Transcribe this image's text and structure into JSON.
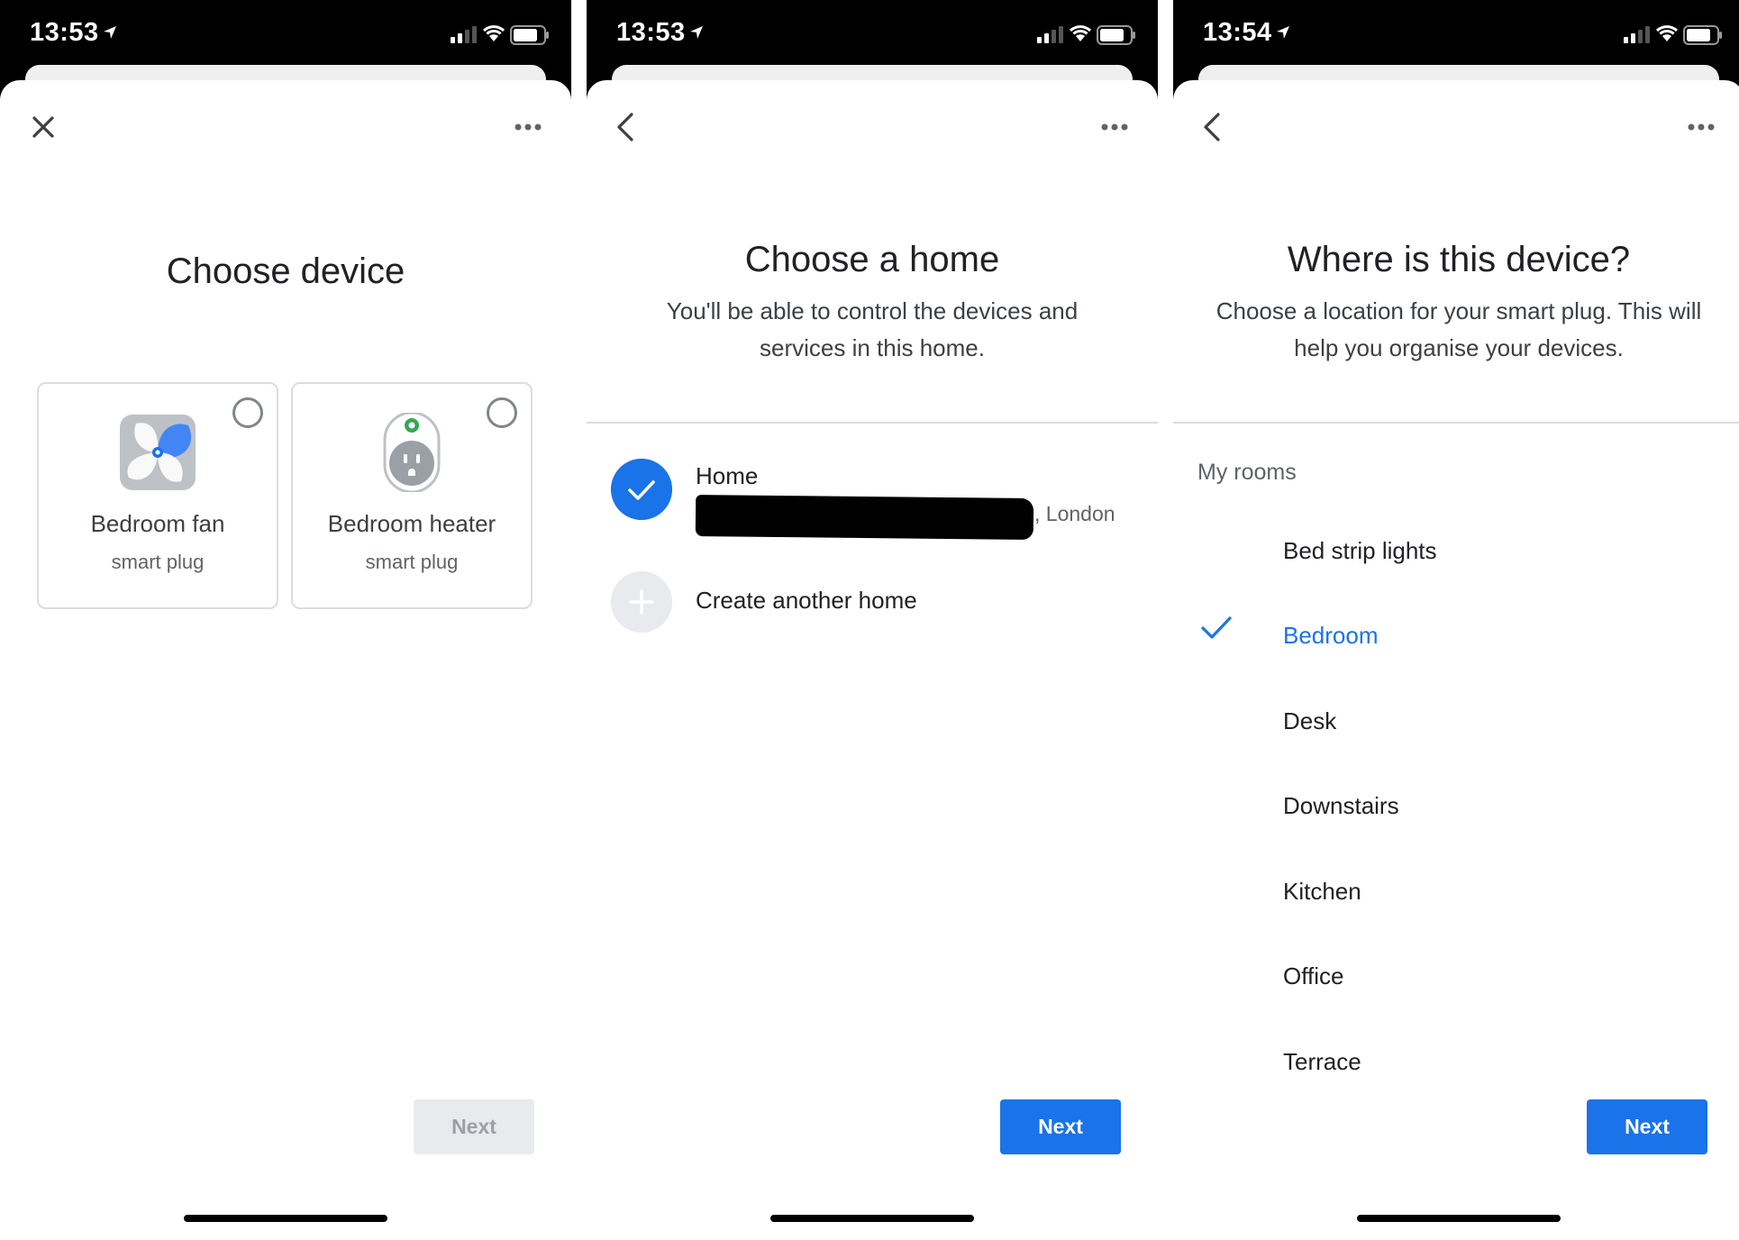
{
  "panels": [
    {
      "status_time": "13:53",
      "top_left_icon": "close-icon",
      "top_right_icon": "more-icon",
      "title": "Choose device",
      "devices": [
        {
          "name": "Bedroom fan",
          "type": "smart plug",
          "icon": "fan-plug-icon",
          "selected": false
        },
        {
          "name": "Bedroom heater",
          "type": "smart plug",
          "icon": "outlet-plug-icon",
          "selected": false
        }
      ],
      "next_label": "Next",
      "next_enabled": false
    },
    {
      "status_time": "13:53",
      "top_left_icon": "back-icon",
      "top_right_icon": "more-icon",
      "title": "Choose a home",
      "subtitle": "You'll be able to control the devices and services in this home.",
      "homes": [
        {
          "name": "Home",
          "address_visible": ", London",
          "selected": true
        }
      ],
      "create_label": "Create another home",
      "next_label": "Next",
      "next_enabled": true
    },
    {
      "status_time": "13:54",
      "top_left_icon": "back-icon",
      "top_right_icon": "more-icon",
      "title": "Where is this device?",
      "subtitle": "Choose a location for your smart plug. This will help you organise your devices.",
      "rooms_header": "My rooms",
      "rooms": [
        "Bed strip lights",
        "Bedroom",
        "Desk",
        "Downstairs",
        "Kitchen",
        "Office",
        "Terrace"
      ],
      "selected_room": "Bedroom",
      "next_label": "Next",
      "next_enabled": true
    }
  ],
  "colors": {
    "accent": "#1a73e8",
    "text": "#202124",
    "muted": "#5f6368",
    "border": "#dadce0",
    "disabled_bg": "#e8eaed",
    "outlet_led": "#34a853"
  }
}
